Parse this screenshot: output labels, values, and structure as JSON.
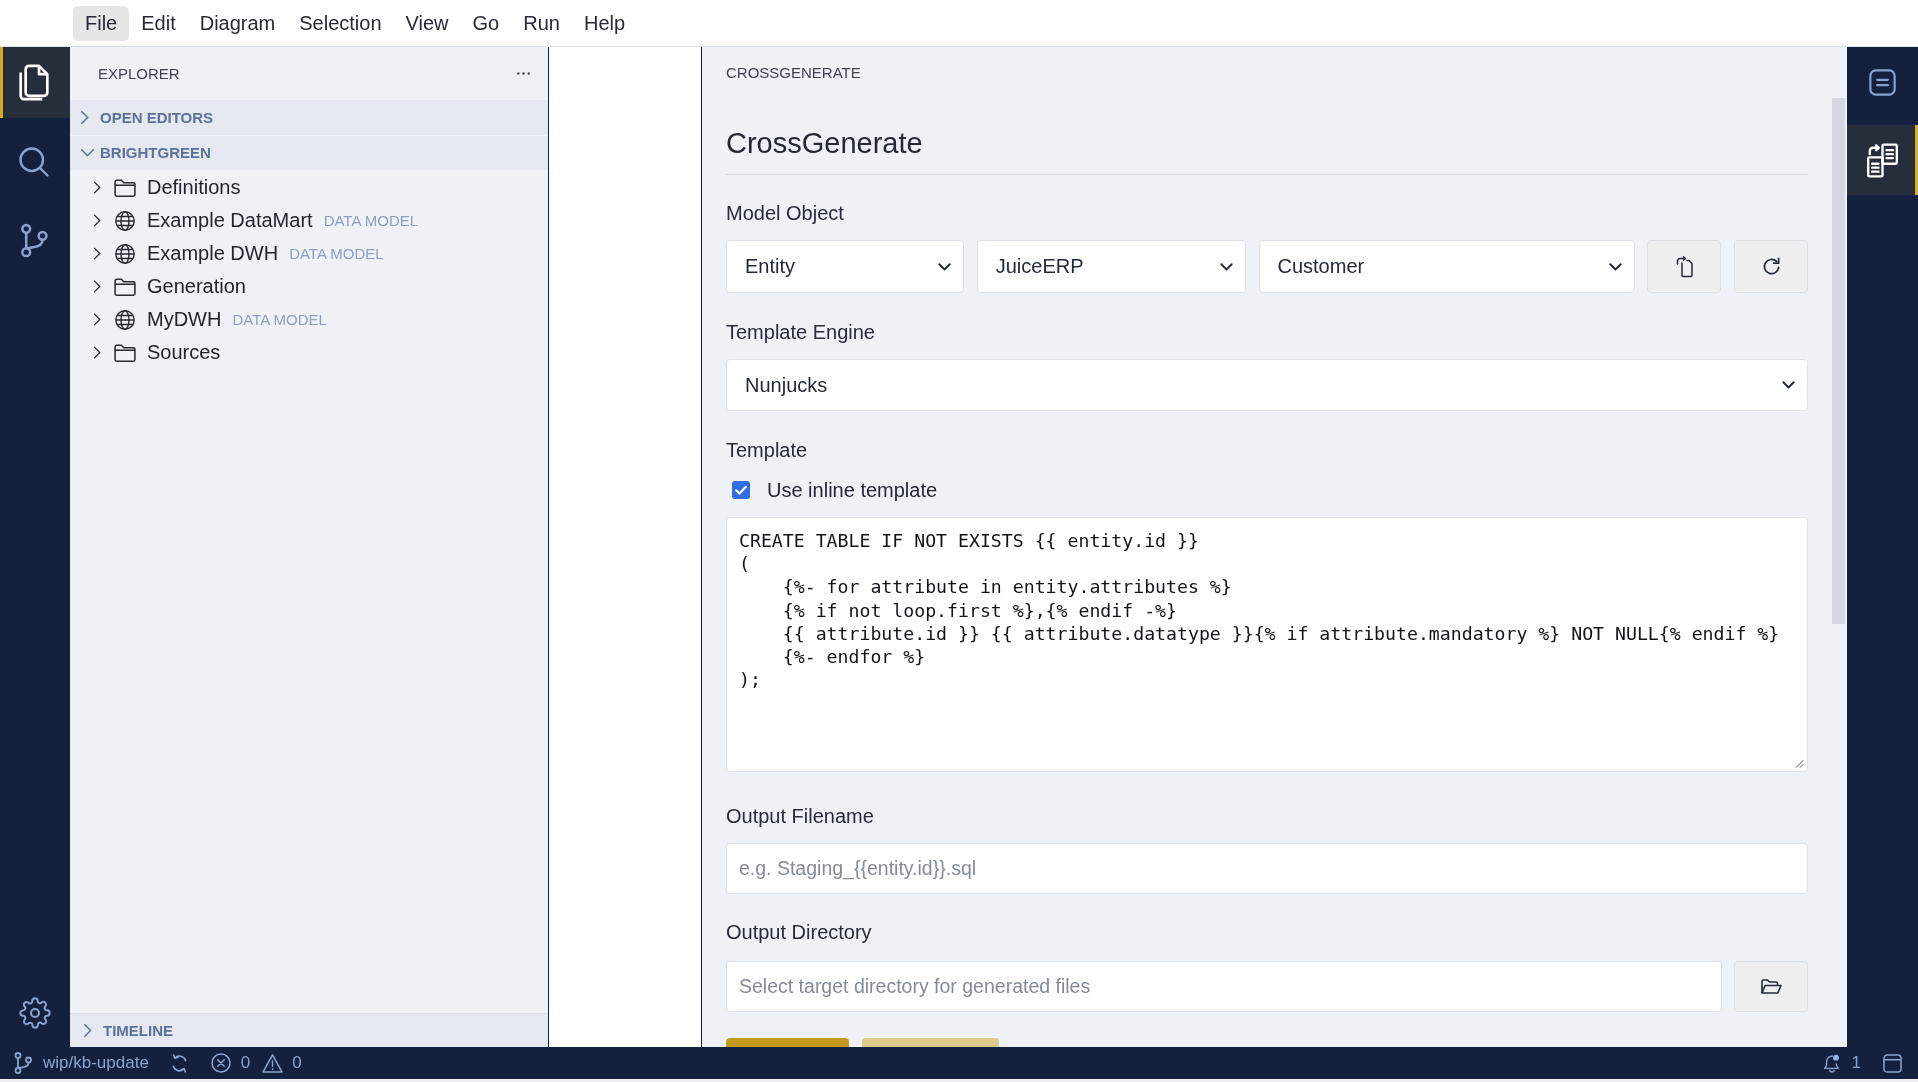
{
  "menu": [
    {
      "label": "File",
      "highlighted": true
    },
    {
      "label": "Edit",
      "highlighted": false
    },
    {
      "label": "Diagram",
      "highlighted": false
    },
    {
      "label": "Selection",
      "highlighted": false
    },
    {
      "label": "View",
      "highlighted": false
    },
    {
      "label": "Go",
      "highlighted": false
    },
    {
      "label": "Run",
      "highlighted": false
    },
    {
      "label": "Help",
      "highlighted": false
    }
  ],
  "activity_bar": [
    {
      "kind": "files",
      "selected": true
    },
    {
      "kind": "search",
      "selected": false
    },
    {
      "kind": "branch",
      "selected": false
    }
  ],
  "sidebar": {
    "title": "EXPLORER",
    "sections": [
      {
        "label": "OPEN EDITORS",
        "expanded": false
      },
      {
        "label": "BRIGHTGREEN",
        "expanded": true,
        "items": [
          {
            "kind": "folder",
            "label": "Definitions",
            "expanded": false
          },
          {
            "kind": "data_model",
            "label": "Example DataMart",
            "description": "DATA MODEL",
            "expanded": false
          },
          {
            "kind": "data_model",
            "label": "Example DWH",
            "description": "DATA MODEL",
            "expanded": false
          },
          {
            "kind": "folder",
            "label": "Generation",
            "expanded": false
          },
          {
            "kind": "data_model",
            "label": "MyDWH",
            "description": "DATA MODEL",
            "expanded": false
          },
          {
            "kind": "folder",
            "label": "Sources",
            "expanded": false
          }
        ]
      }
    ],
    "timeline": {
      "label": "TIMELINE",
      "expanded": false
    }
  },
  "panel": {
    "header": "CROSSGENERATE",
    "title": "CrossGenerate",
    "model_object": {
      "label": "Model Object",
      "dropdowns": [
        "Entity",
        "JuiceERP",
        "Customer"
      ]
    },
    "template_engine": {
      "label": "Template Engine",
      "value": "Nunjucks"
    },
    "template": {
      "label": "Template",
      "inline_option": {
        "label": "Use inline template",
        "checked": true
      },
      "code_lines": [
        "CREATE TABLE IF NOT EXISTS {{ entity.id }}",
        "(",
        "    {%- for attribute in entity.attributes %}",
        "    {% if not loop.first %},{% endif -%}",
        "    {{ attribute.id }} {{ attribute.datatype }}{% if attribute.mandatory %} NOT NULL{% endif %}",
        "    {%- endfor %}",
        ");"
      ]
    },
    "output_filename": {
      "label": "Output Filename",
      "placeholder": "e.g. Staging_{{entity.id}}.sql"
    },
    "output_directory": {
      "label": "Output Directory",
      "placeholder": "Select target directory for generated files"
    },
    "actions": [
      {
        "kind": "primary"
      },
      {
        "kind": "secondary"
      }
    ]
  },
  "right_bar": [
    {
      "kind": "list",
      "selected": false
    },
    {
      "kind": "file_transfer",
      "selected": true
    }
  ],
  "status_bar": {
    "branch": "wip/kb-update",
    "errors": "0",
    "warnings": "0",
    "notifications": "1"
  }
}
